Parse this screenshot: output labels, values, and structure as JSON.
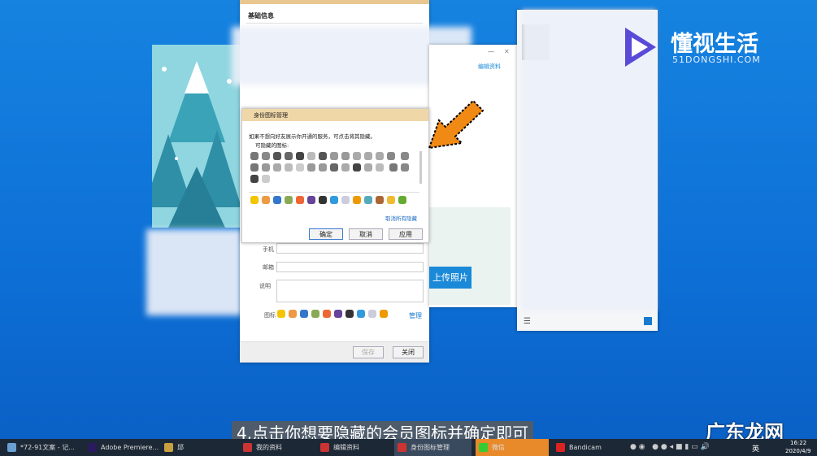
{
  "edit_window": {
    "section_title": "基础信息",
    "labels": [
      "手机",
      "邮箱",
      "说明",
      "图标"
    ],
    "manage_link": "管理",
    "save": "保存",
    "close": "关闭"
  },
  "dialog": {
    "title": "身份图标管理",
    "hint": "如果不想向好友展示你开通的服务，可点击将其隐藏。",
    "hidable_label": "可隐藏的图标:",
    "unhide_all": "取消所有隐藏",
    "ok": "确定",
    "cancel": "取消",
    "apply": "应用"
  },
  "profile_window": {
    "edit_link": "编辑资料",
    "upload_photo": "上传照片",
    "minimize": "—",
    "close": "✕"
  },
  "logo": {
    "name": "懂视生活",
    "domain": "51DONGSHI.COM"
  },
  "subtitle": "4.点击你想要隐藏的会员图标并确定即可",
  "watermark": "广东龙网",
  "taskbar": {
    "items": [
      {
        "label": "*72-91文案 - 记...",
        "color": "#6aa0d0"
      },
      {
        "label": "Adobe Premiere...",
        "color": "#2a1a5e"
      },
      {
        "label": "邱",
        "color": "#c9a040"
      },
      {
        "label": "我的资料",
        "color": "#d33"
      },
      {
        "label": "编辑资料",
        "color": "#d33"
      },
      {
        "label": "身份图标管理",
        "color": "#d33"
      },
      {
        "label": "微信",
        "color": "#3c3"
      },
      {
        "label": "Bandicam",
        "color": "#d22"
      }
    ],
    "ime": "英",
    "time": "16:22",
    "date": "2020/4/9"
  }
}
